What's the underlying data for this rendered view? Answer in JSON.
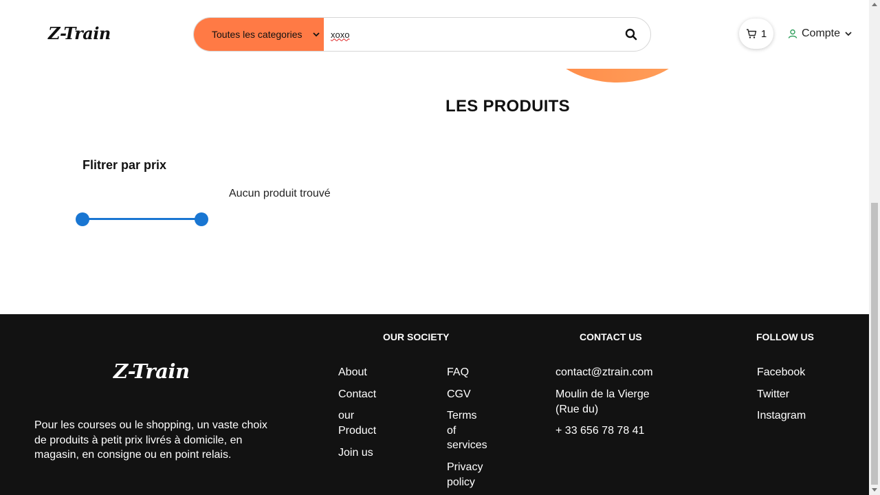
{
  "header": {
    "logo": "Z-Train",
    "category_select": "Toutes les categories",
    "search_value": "xoxo",
    "cart_count": "1",
    "account_label": "Compte"
  },
  "main": {
    "section_title": "LES PRODUITS",
    "filter_title": "Flitrer par prix",
    "no_product": "Aucun produit trouvé"
  },
  "footer": {
    "logo": "Z-Train",
    "description": "Pour les courses ou le shopping, un vaste choix de produits à petit prix livrés à domicile, en magasin, en consigne ou en point relais.",
    "society_heading": "OUR SOCIETY",
    "society_col1": [
      "About",
      "Contact",
      "our Product",
      "Join us"
    ],
    "society_col2": [
      "FAQ",
      "CGV",
      "Terms of services",
      "Privacy policy"
    ],
    "contact_heading": "CONTACT US",
    "contact": [
      "contact@ztrain.com",
      "Moulin de la Vierge (Rue du)",
      "+ 33 656 78 78 41"
    ],
    "follow_heading": "FOLLOW US",
    "follow": [
      "Facebook",
      "Twitter",
      "Instagram"
    ]
  },
  "colors": {
    "accent_orange": "#ff7a45",
    "slider_blue": "#1976d2",
    "footer_bg": "#121212"
  }
}
